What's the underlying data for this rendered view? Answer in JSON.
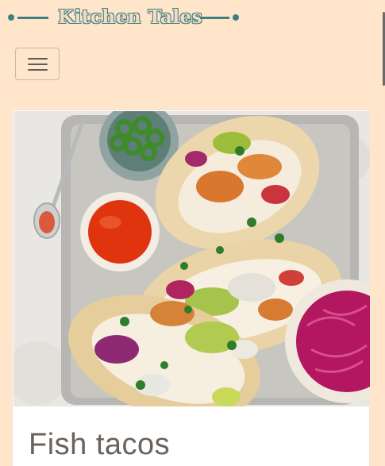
{
  "site": {
    "brand_title": "Kitchen Tales",
    "accent_color": "#3f7f86",
    "background_color": "#ffe5c9"
  },
  "nav": {
    "menu_icon": "hamburger-icon"
  },
  "recipe_card": {
    "title": "Fish tacos"
  }
}
